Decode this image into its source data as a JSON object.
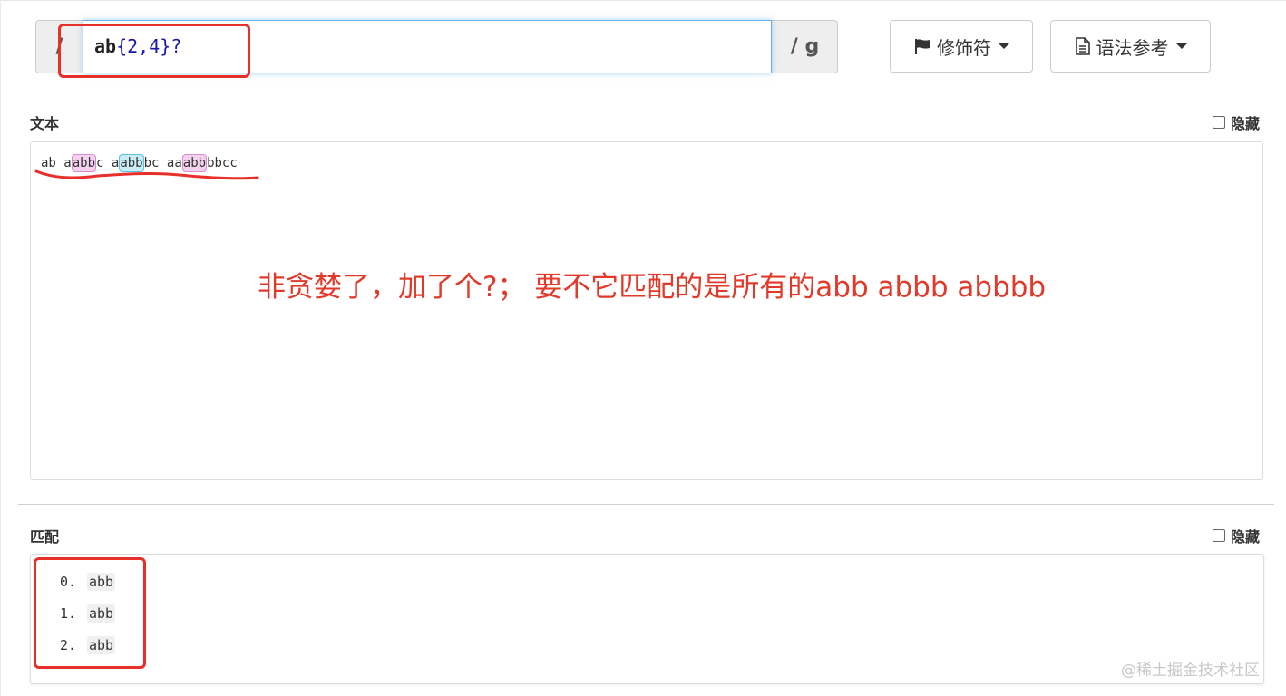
{
  "regex": {
    "open_delim": "/",
    "literal": "ab",
    "quantifier": "{2,4}",
    "lazy": "?",
    "flags": "/ g"
  },
  "toolbar": {
    "modifiers_label": "修饰符",
    "modifiers_icon": "flag-icon",
    "syntax_label": "语法参考",
    "syntax_icon": "document-icon"
  },
  "text_section": {
    "title": "文本",
    "hide_label": "隐藏",
    "segments": [
      {
        "t": "ab a",
        "hl": ""
      },
      {
        "t": "abb",
        "hl": "pink"
      },
      {
        "t": "c a",
        "hl": ""
      },
      {
        "t": "abb",
        "hl": "cyan"
      },
      {
        "t": "bc aa",
        "hl": ""
      },
      {
        "t": "abb",
        "hl": "pink"
      },
      {
        "t": "bbcc",
        "hl": ""
      }
    ]
  },
  "annotation": "非贪婪了，加了个?； 要不它匹配的是所有的abb abbb abbbb",
  "matches_section": {
    "title": "匹配",
    "hide_label": "隐藏",
    "items": [
      {
        "index": "0.",
        "value": "abb"
      },
      {
        "index": "1.",
        "value": "abb"
      },
      {
        "index": "2.",
        "value": "abb"
      }
    ]
  },
  "watermark": "@稀土掘金技术社区",
  "colors": {
    "annotation_red": "#e23a2a",
    "match_pink": "#f4d2ef",
    "match_cyan": "#c9ecf7",
    "focus_blue": "#66afe9"
  }
}
